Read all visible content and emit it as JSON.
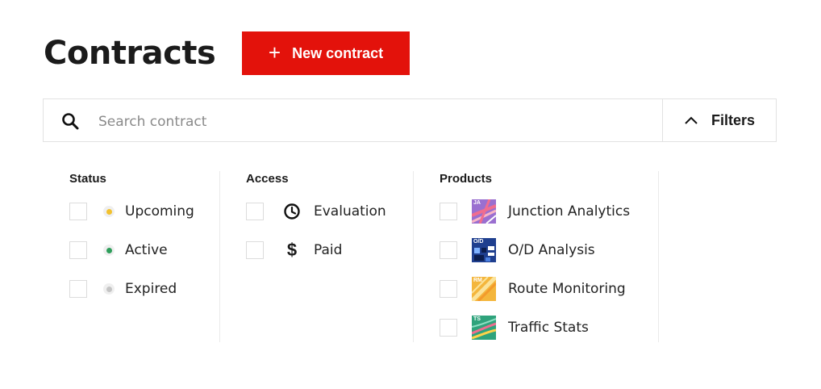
{
  "header": {
    "title": "Contracts",
    "new_button": {
      "icon": "+",
      "label": "New contract"
    }
  },
  "search": {
    "placeholder": "Search contract",
    "value": "",
    "filters_label": "Filters",
    "filters_icon": "chevron-up-icon"
  },
  "filters": {
    "status": {
      "heading": "Status",
      "items": [
        {
          "label": "Upcoming",
          "color": "#f2c12e",
          "checked": false
        },
        {
          "label": "Active",
          "color": "#2e9e5b",
          "checked": false
        },
        {
          "label": "Expired",
          "color": "#c4c4c4",
          "checked": false
        }
      ]
    },
    "access": {
      "heading": "Access",
      "items": [
        {
          "label": "Evaluation",
          "icon": "clock-icon",
          "checked": false
        },
        {
          "label": "Paid",
          "icon": "dollar-icon",
          "checked": false
        }
      ]
    },
    "products": {
      "heading": "Products",
      "items": [
        {
          "label": "Junction Analytics",
          "abbr": "JA",
          "icon": "junction-analytics-icon",
          "checked": false
        },
        {
          "label": "O/D Analysis",
          "abbr": "O/D",
          "icon": "od-analysis-icon",
          "checked": false
        },
        {
          "label": "Route Monitoring",
          "abbr": "RM",
          "icon": "route-monitoring-icon",
          "checked": false
        },
        {
          "label": "Traffic Stats",
          "abbr": "TS",
          "icon": "traffic-stats-icon",
          "checked": false
        }
      ]
    }
  },
  "colors": {
    "accent": "#e3120b",
    "border": "#e2e2e2"
  }
}
